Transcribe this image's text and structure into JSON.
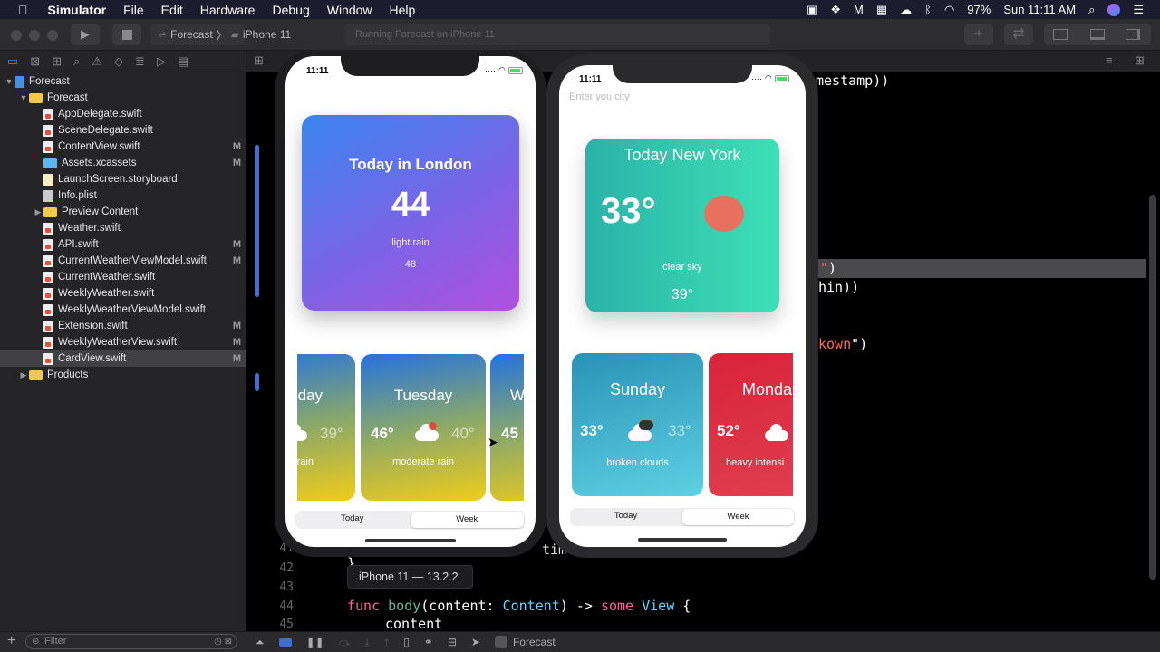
{
  "menubar": {
    "app": "Simulator",
    "items": [
      "File",
      "Edit",
      "Hardware",
      "Debug",
      "Window",
      "Help"
    ],
    "battery": "97%",
    "clock": "Sun 11:11 AM"
  },
  "toolbar": {
    "scheme": "Forecast",
    "device": "iPhone 11",
    "status": "Running Forecast on iPhone 11"
  },
  "navigator": {
    "root": "Forecast",
    "items": [
      {
        "label": "Forecast",
        "type": "folder",
        "level": 1,
        "open": true
      },
      {
        "label": "AppDelegate.swift",
        "type": "swift",
        "level": 2,
        "badge": ""
      },
      {
        "label": "SceneDelegate.swift",
        "type": "swift",
        "level": 2,
        "badge": ""
      },
      {
        "label": "ContentView.swift",
        "type": "swift",
        "level": 2,
        "badge": "M"
      },
      {
        "label": "Assets.xcassets",
        "type": "assets",
        "level": 2,
        "badge": "M"
      },
      {
        "label": "LaunchScreen.storyboard",
        "type": "storyboard",
        "level": 2,
        "badge": ""
      },
      {
        "label": "Info.plist",
        "type": "plist",
        "level": 2,
        "badge": ""
      },
      {
        "label": "Preview Content",
        "type": "folder",
        "level": 2,
        "open": false
      },
      {
        "label": "Weather.swift",
        "type": "swift",
        "level": 2,
        "badge": ""
      },
      {
        "label": "API.swift",
        "type": "swift",
        "level": 2,
        "badge": "M"
      },
      {
        "label": "CurrentWeatherViewModel.swift",
        "type": "swift",
        "level": 2,
        "badge": "M"
      },
      {
        "label": "CurrentWeather.swift",
        "type": "swift",
        "level": 2,
        "badge": ""
      },
      {
        "label": "WeeklyWeather.swift",
        "type": "swift",
        "level": 2,
        "badge": ""
      },
      {
        "label": "WeeklyWeatherViewModel.swift",
        "type": "swift",
        "level": 2,
        "badge": ""
      },
      {
        "label": "Extension.swift",
        "type": "swift",
        "level": 2,
        "badge": "M"
      },
      {
        "label": "WeeklyWeatherView.swift",
        "type": "swift",
        "level": 2,
        "badge": "M"
      },
      {
        "label": "CardView.swift",
        "type": "swift",
        "level": 2,
        "badge": "M",
        "selected": true
      },
      {
        "label": "Products",
        "type": "folder",
        "level": 1,
        "open": false
      }
    ],
    "filter_placeholder": "Filter"
  },
  "editor": {
    "fragments": {
      "a": "mestamp))",
      "b": ")",
      "c": "hin))",
      "d": "kown",
      "d2": "\")",
      "e": "tim",
      "f": "}"
    },
    "line_numbers": [
      "41",
      "42",
      "43",
      "44",
      "45"
    ],
    "line44": {
      "kw1": "func",
      "name": "body",
      "p1": "(content: ",
      "type1": "Content",
      "p2": ") -> ",
      "kw2": "some",
      "type2": "View",
      "p3": " {"
    },
    "line45": "content"
  },
  "tooltip": "iPhone 11 — 13.2.2",
  "debugbar": {
    "target": "Forecast"
  },
  "phone1": {
    "time": "11:11",
    "today": {
      "title": "Today in London",
      "temp": "44",
      "desc": "light rain",
      "feels": "48"
    },
    "week": [
      {
        "day": "day",
        "hi": "",
        "lo": "39°",
        "desc": "rain"
      },
      {
        "day": "Tuesday",
        "hi": "46°",
        "lo": "40°",
        "desc": "moderate rain"
      },
      {
        "day": "W",
        "hi": "45",
        "lo": "",
        "desc": ""
      }
    ],
    "tabs": [
      "Today",
      "Week"
    ],
    "selected_tab": "Week"
  },
  "phone2": {
    "time": "11:11",
    "city_placeholder": "Enter you city",
    "today": {
      "title": "Today New York",
      "temp": "33°",
      "desc": "clear sky",
      "feels": "39°"
    },
    "week": [
      {
        "day": "Sunday",
        "hi": "33°",
        "lo": "33°",
        "desc": "broken clouds"
      },
      {
        "day": "Monda",
        "hi": "52°",
        "lo": "",
        "desc": "heavy intensi"
      }
    ],
    "tabs": [
      "Today",
      "Week"
    ],
    "selected_tab": "Week"
  },
  "colors": {
    "accent": "#3b82f6",
    "london_card": [
      "#3a86f0",
      "#b050e0"
    ],
    "ny_card": [
      "#2ab3a8",
      "#3de0b6"
    ],
    "sunday_card": [
      "#2a92b6",
      "#5dd0e2"
    ],
    "monday_card": "#d9233a",
    "tue_card": [
      "#2472e0",
      "#f0cc1a"
    ],
    "sun_dot": "#e8705e"
  }
}
